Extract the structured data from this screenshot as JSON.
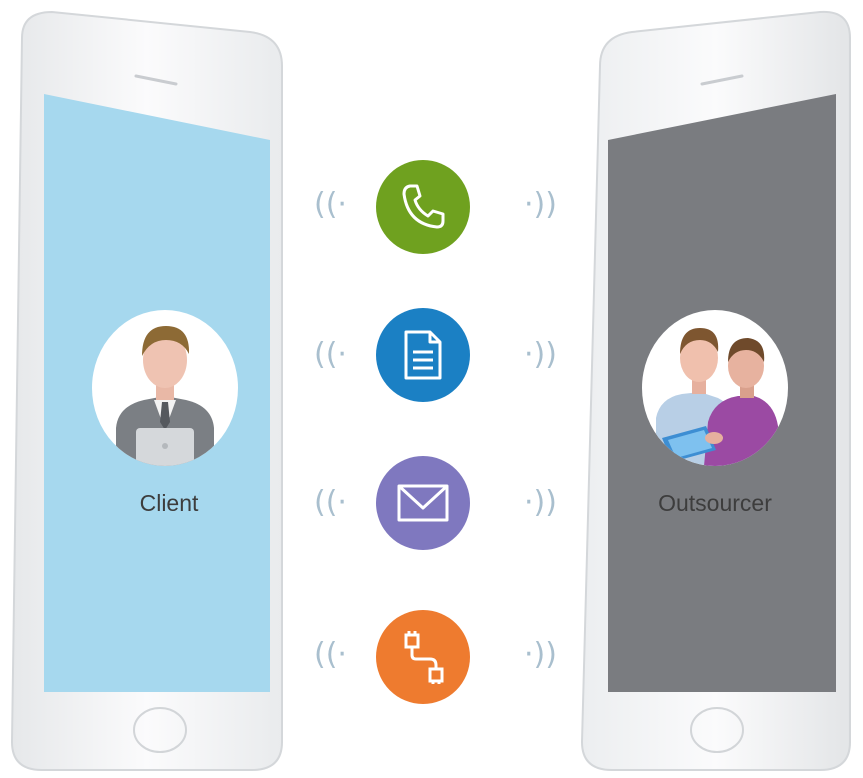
{
  "client": {
    "label": "Client",
    "avatar_icon": "businessman-laptop-icon",
    "screen_color": "#a6d8ee"
  },
  "outsourcer": {
    "label": "Outsourcer",
    "avatar_icon": "two-colleagues-tablet-icon",
    "screen_color": "#7a7c80"
  },
  "channels": [
    {
      "id": "phone",
      "icon": "phone-icon",
      "color": "#6fa11f"
    },
    {
      "id": "document",
      "icon": "document-icon",
      "color": "#1b80c4"
    },
    {
      "id": "email",
      "icon": "envelope-icon",
      "color": "#7f78bf"
    },
    {
      "id": "connection",
      "icon": "cable-connector-icon",
      "color": "#ee7b2f"
    }
  ],
  "signal": {
    "left_glyph": "((·",
    "right_glyph": "·))",
    "color": "#a9bfce"
  }
}
